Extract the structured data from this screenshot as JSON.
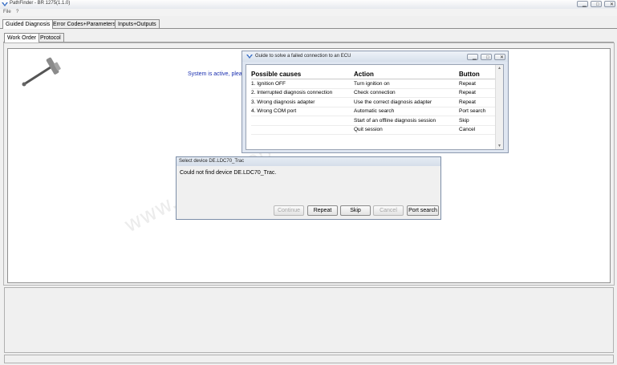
{
  "window": {
    "title": "PathFinder - BR 1275(1.1.0)",
    "buttons": [
      "▁",
      "□",
      "✕"
    ]
  },
  "menu": {
    "file": "File",
    "help": "?"
  },
  "tabs": [
    {
      "label": "Guided Diagnosis",
      "active": true
    },
    {
      "label": "Error Codes+Parameters",
      "active": false
    },
    {
      "label": "Inputs+Outputs",
      "active": false
    }
  ],
  "subtabs": [
    {
      "label": "Work Order",
      "active": true
    },
    {
      "label": "Protocol",
      "active": false
    }
  ],
  "main": {
    "status_text": "System is active, plea",
    "watermark": "www.obdii.shop"
  },
  "guide_dialog": {
    "title": "Guide to solve a failed connection to an ECU",
    "headers": {
      "causes": "Possible causes",
      "action": "Action",
      "button": "Button"
    },
    "rows": [
      {
        "cause": "1. Ignition OFF",
        "action": "Turn ignition on",
        "button": "Repeat"
      },
      {
        "cause": "2. Interrupted diagnosis connection",
        "action": "Check connection",
        "button": "Repeat"
      },
      {
        "cause": "3. Wrong diagnosis adapter",
        "action": "Use the correct diagnosis adapter",
        "button": "Repeat"
      },
      {
        "cause": "4. Wrong COM port",
        "action": "Automatic search",
        "button": "Port search"
      },
      {
        "cause": "",
        "action": "Start of an offline diagnosis session",
        "button": "Skip"
      },
      {
        "cause": "",
        "action": "Quit session",
        "button": "Cancel"
      }
    ]
  },
  "device_dialog": {
    "title": "Select device DE.LDC70_Trac",
    "message": "Could not find device DE.LDC70_Trac.",
    "buttons": {
      "continue": "Continue",
      "repeat": "Repeat",
      "skip": "Skip",
      "cancel": "Cancel",
      "port_search": "Port search"
    }
  }
}
